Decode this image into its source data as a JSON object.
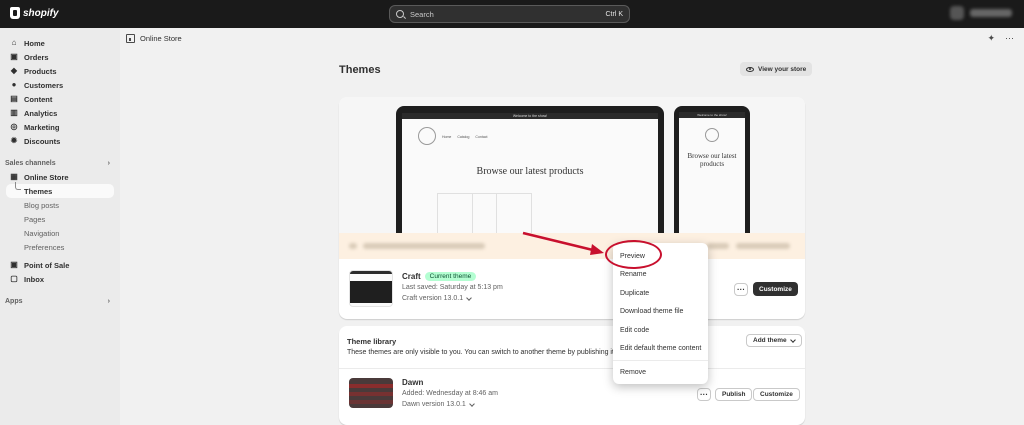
{
  "topbar": {
    "brand": "shopify",
    "search_placeholder": "Search",
    "search_shortcut": "Ctrl K"
  },
  "sidebar": {
    "items": [
      {
        "label": "Home",
        "icon": "home-icon"
      },
      {
        "label": "Orders",
        "icon": "orders-icon"
      },
      {
        "label": "Products",
        "icon": "tag-icon"
      },
      {
        "label": "Customers",
        "icon": "person-icon"
      },
      {
        "label": "Content",
        "icon": "content-icon"
      },
      {
        "label": "Analytics",
        "icon": "chart-icon"
      },
      {
        "label": "Marketing",
        "icon": "target-icon"
      },
      {
        "label": "Discounts",
        "icon": "discount-icon"
      }
    ],
    "sales_channels_heading": "Sales channels",
    "online_store": "Online Store",
    "online_store_sub": [
      "Themes",
      "Blog posts",
      "Pages",
      "Navigation",
      "Preferences"
    ],
    "point_of_sale": "Point of Sale",
    "inbox": "Inbox",
    "apps_heading": "Apps"
  },
  "breadcrumb": {
    "label": "Online Store"
  },
  "page": {
    "title": "Themes",
    "view_store_label": "View your store"
  },
  "preview": {
    "banner_text": "Welcome to the show!",
    "nav": [
      "Home",
      "Catalog",
      "Contact"
    ],
    "heading": "Browse our latest products"
  },
  "current_theme": {
    "name": "Craft",
    "badge": "Current theme",
    "last_saved": "Last saved: Saturday at 5:13 pm",
    "version": "Craft version 13.0.1",
    "customize_label": "Customize"
  },
  "library": {
    "title": "Theme library",
    "description": "These themes are only visible to you. You can switch to another theme by publishing it",
    "add_theme_label": "Add theme",
    "themes": [
      {
        "name": "Dawn",
        "added": "Added: Wednesday at 8:46 am",
        "version": "Dawn version 13.0.1",
        "publish_label": "Publish",
        "customize_label": "Customize"
      }
    ]
  },
  "menu": {
    "items": [
      "Preview",
      "Rename",
      "Duplicate",
      "Download theme file",
      "Edit code",
      "Edit default theme content",
      "Remove"
    ]
  },
  "colors": {
    "topbar": "#1a1a1a",
    "annotation": "#c8102e",
    "badge_bg": "#b4fed2",
    "primary_button": "#303030"
  }
}
